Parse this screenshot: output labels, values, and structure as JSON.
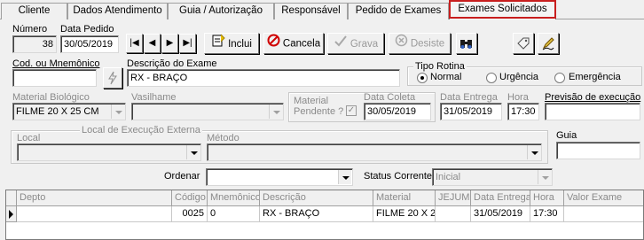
{
  "tabs": [
    "Cliente",
    "Dados Atendimento",
    "Guia / Autorização",
    "Responsável",
    "Pedido de Exames",
    "Exames Solicitados"
  ],
  "form": {
    "numero_label": "Número",
    "numero_value": "38",
    "data_pedido_label": "Data Pedido",
    "data_pedido_value": "30/05/2019",
    "cod_label": "Cod. ou Mnemônico",
    "cod_value": "",
    "descricao_label": "Descrição do Exame",
    "descricao_value": "RX - BRAÇO",
    "tipo_rotina_label": "Tipo Rotina",
    "tipo_rotina_options": [
      "Normal",
      "Urgência",
      "Emergência"
    ],
    "tipo_rotina_selected": "Normal",
    "material_label": "Material Biológico",
    "material_value": "FILME 20 X 25 CM",
    "vasilhame_label": "Vasilhame",
    "vasilhame_value": "",
    "material_pendente_label_1": "Material",
    "material_pendente_label_2": "Pendente ?",
    "data_coleta_label": "Data Coleta",
    "data_coleta_value": "30/05/2019",
    "data_entrega_label": "Data Entrega",
    "data_entrega_value": "31/05/2019",
    "hora_label": "Hora",
    "hora_value": "17:30",
    "previsao_label": "Previsão de execução",
    "previsao_value": "",
    "local_execucao_group": "Local de Execução Externa",
    "local_label": "Local",
    "local_value": "",
    "metodo_label": "Método",
    "metodo_value": "",
    "guia_label": "Guia",
    "guia_value": "",
    "ordenar_label": "Ordenar",
    "ordenar_value": "",
    "status_label": "Status Corrente:",
    "status_value": "Inicial"
  },
  "toolbar": {
    "first": "|◀",
    "prev": "◀",
    "next": "▶",
    "last": "▶|",
    "inclui": "Inclui",
    "cancela": "Cancela",
    "grava": "Grava",
    "desiste": "Desiste"
  },
  "grid": {
    "columns": [
      "Depto",
      "Código",
      "Mnemônico",
      "Descrição",
      "Material",
      "JEJUM",
      "Data Entrega",
      "Hora",
      "Valor Exame"
    ],
    "rows": [
      [
        "",
        "0025",
        "0",
        "RX - BRAÇO",
        "FILME 20 X 25",
        "",
        "31/05/2019",
        "17:30",
        ""
      ]
    ]
  },
  "colors": {
    "highlight": "#c81e1e",
    "window_bg": "#f0f0f0"
  }
}
